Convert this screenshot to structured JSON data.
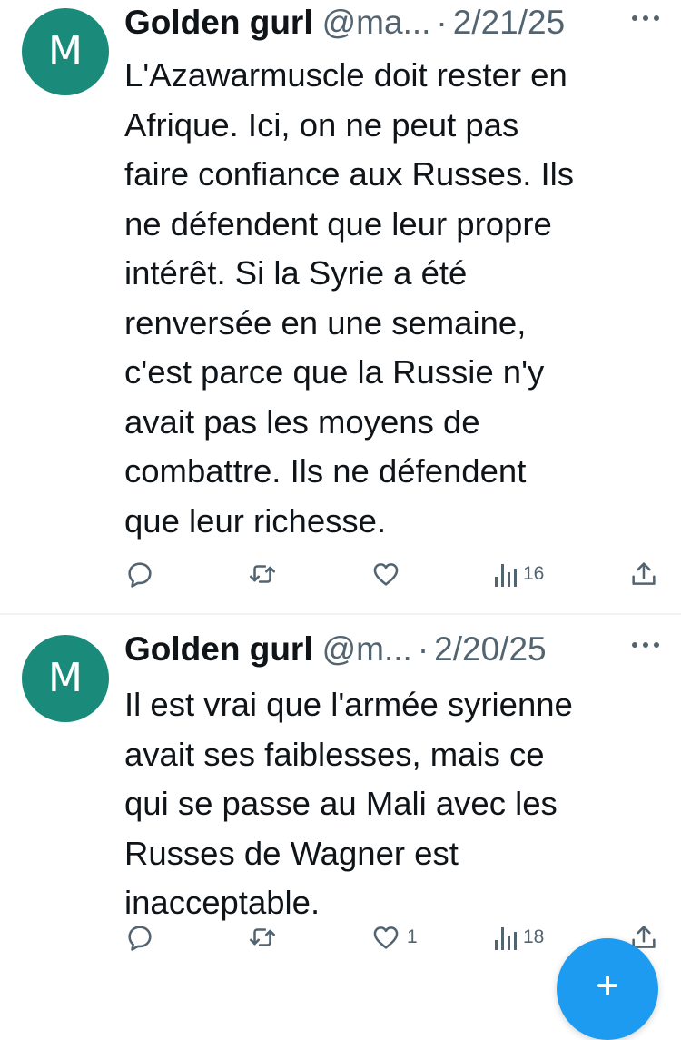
{
  "tweets": [
    {
      "avatar_letter": "M",
      "display_name": "Golden gurl",
      "handle": "@ma...",
      "separator": "·",
      "date": "2/21/25",
      "text": "L'Azawarmuscle doit rester en\nAfrique. Ici, on ne peut pas\nfaire confiance aux Russes. Ils\nne défendent que leur propre\nintérêt. Si la Syrie a été\nrenversée en une semaine,\nc'est parce que la Russie n'y\navait pas les moyens de\ncombattre. Ils ne défendent\nque leur richesse.",
      "likes": "",
      "views": "16"
    },
    {
      "avatar_letter": "M",
      "display_name": "Golden gurl",
      "handle": "@m...",
      "separator": "·",
      "date": "2/20/25",
      "text": "Il est vrai que l'armée syrienne\navait ses faiblesses, mais ce\nqui se passe au Mali avec les\nRusses de Wagner est\ninacceptable.",
      "likes": "1",
      "views": "18"
    }
  ],
  "icons": {
    "reply": "reply-icon",
    "repost": "repost-icon",
    "like": "like-icon",
    "views": "views-icon",
    "share": "share-icon",
    "more": "more-icon",
    "compose": "compose-plus-icon"
  },
  "colors": {
    "avatar": "#1a8a7a",
    "accent": "#1d9bf0",
    "secondary_text": "#536471",
    "primary_text": "#0f1419"
  }
}
